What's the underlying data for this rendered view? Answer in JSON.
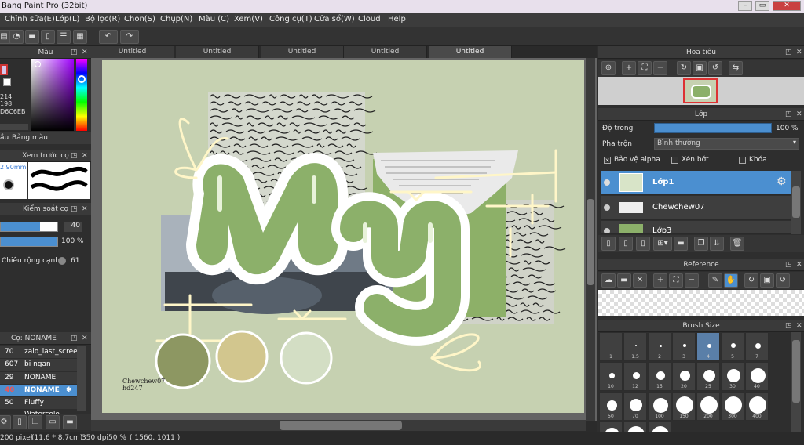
{
  "window": {
    "title": "Bang Paint Pro (32bit)"
  },
  "menu": [
    "Chỉnh sửa(E)",
    "Lớp(L)",
    "Bộ lọc(R)",
    "Chọn(S)",
    "Chụp(N)",
    "Màu (C)",
    "Xem(V)",
    "Công cụ(T)",
    "Cửa sổ(W)",
    "Cloud",
    "Help"
  ],
  "tabs": [
    "Untitled",
    "Untitled",
    "Untitled",
    "Untitled",
    "Untitled"
  ],
  "left": {
    "color_panel_title": "Màu",
    "color_values": {
      "v1": "214",
      "v2": "198",
      "hex": "D6C6EB"
    },
    "color_tabs": [
      "ầu",
      "Bảng màu"
    ],
    "preview_title": "Xem trước cọ",
    "preview_size": "2.90mm",
    "brush_control_title": "Kiểm soát cọ",
    "slider1_value": "40",
    "slider1_fill": 0.7,
    "slider2_value": "100 %",
    "slider2_fill": 1.0,
    "width_label": "Chiều rộng cạnh",
    "width_value": "61",
    "brushes_title": "Cọ: NONAME",
    "brushes": [
      {
        "size": "70",
        "name": "zalo_last_screen",
        "selected": false
      },
      {
        "size": "607",
        "name": "bi ngan",
        "selected": false
      },
      {
        "size": "29",
        "name": "NONAME",
        "selected": false
      },
      {
        "size": "40",
        "name": "NONAME",
        "selected": true
      },
      {
        "size": "50",
        "name": "Fluffy Watercolo",
        "selected": false
      }
    ]
  },
  "canvas": {
    "signature_line1": "Chewchew07",
    "signature_line2": "hd247"
  },
  "status": {
    "size": "200 pixel",
    "dims": "(11.6 * 8.7cm)",
    "dpi": "350 dpi",
    "zoom": "50 %",
    "coords": "( 1560, 1011 )"
  },
  "right": {
    "navigator_title": "Hoa tiêu",
    "layer_title": "Lớp",
    "opacity_label": "Độ trong",
    "opacity_value": "100 %",
    "blend_label": "Pha trộn",
    "blend_value": "Bình thường",
    "protect_alpha": "Bảo vệ alpha",
    "clip": "Xén bớt",
    "lock": "Khóa",
    "layers": [
      {
        "name": "Lớp1",
        "selected": true
      },
      {
        "name": "Chewchew07",
        "selected": false
      },
      {
        "name": "Lớp3",
        "selected": false
      }
    ],
    "reference_title": "Reference",
    "brushsize_title": "Brush Size",
    "brush_sizes": [
      "1",
      "1.5",
      "2",
      "3",
      "4",
      "5",
      "7",
      "10",
      "12",
      "15",
      "20",
      "25",
      "30",
      "40",
      "50",
      "70",
      "100",
      "150",
      "200",
      "300",
      "400",
      "",
      "",
      ""
    ],
    "brush_selected_index": 4
  },
  "colors": {
    "accent_blue": "#4b8fd0",
    "canvas_bg": "#c6d1b1",
    "green_letter": "#8cb06a"
  }
}
